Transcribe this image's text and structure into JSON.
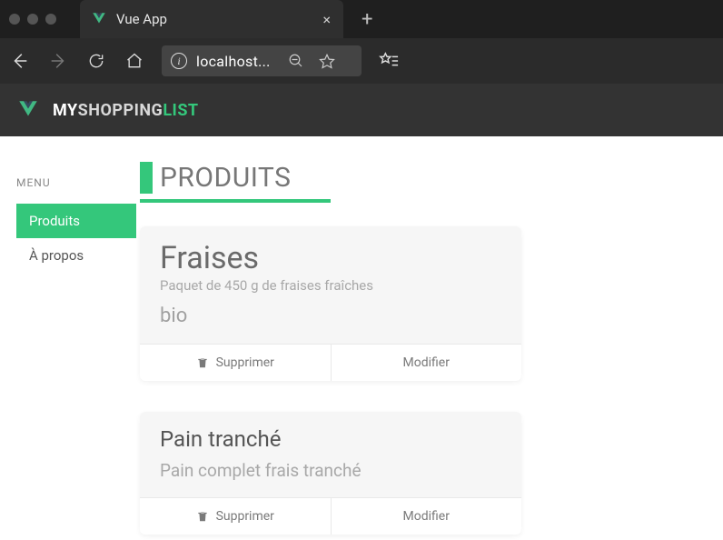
{
  "browser": {
    "tab_title": "Vue App",
    "url_display": "localhost..."
  },
  "app": {
    "brand_my": "MY",
    "brand_shopping": "SHOPPING",
    "brand_list": "LIST"
  },
  "sidebar": {
    "menu_label": "MENU",
    "items": [
      {
        "label": "Produits",
        "active": true
      },
      {
        "label": "À propos",
        "active": false
      }
    ]
  },
  "page": {
    "title": "PRODUITS"
  },
  "products": [
    {
      "name": "Fraises",
      "description": "Paquet de 450 g de fraises fraîches",
      "tag": "bio",
      "actions": {
        "delete": "Supprimer",
        "edit": "Modifier"
      }
    },
    {
      "name": "Pain tranché",
      "description": "Pain complet frais tranché",
      "tag": "",
      "actions": {
        "delete": "Supprimer",
        "edit": "Modifier"
      }
    }
  ],
  "colors": {
    "accent": "#34c77b"
  }
}
